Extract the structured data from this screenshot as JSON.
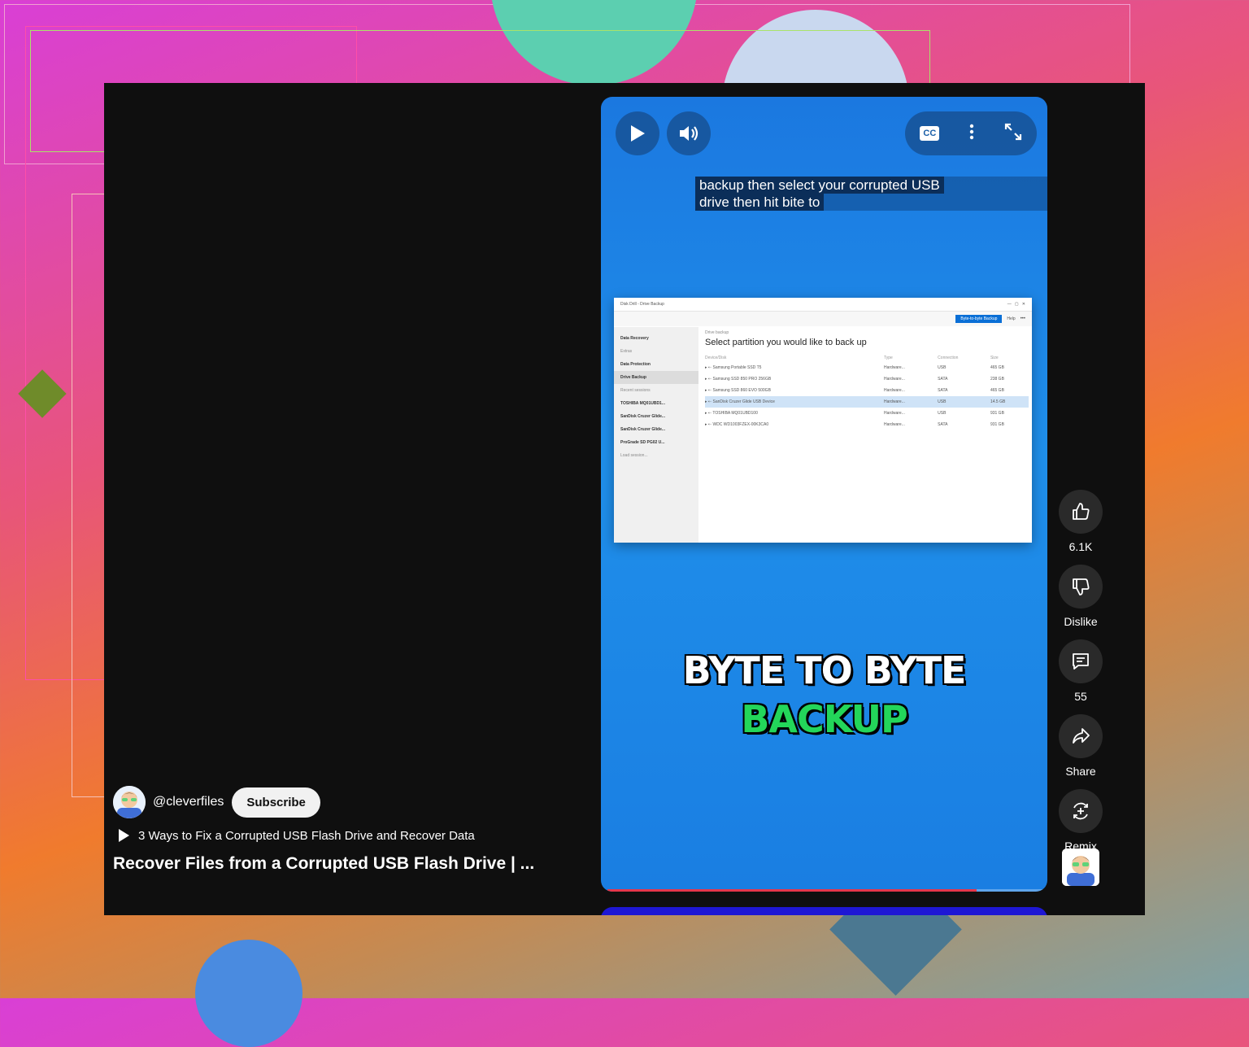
{
  "video": {
    "caption_line1": "backup then select your corrupted USB",
    "caption_line2": "drive then hit bite to",
    "overlay_line1": "BYTE TO BYTE",
    "overlay_line2": "BACKUP",
    "progress": 0.84,
    "controls": {
      "play_icon": "play-icon",
      "volume_icon": "volume-icon",
      "cc_label": "CC"
    }
  },
  "embedded_window": {
    "title": "Disk Drill - Drive Backup",
    "primary_button": "Byte-to-byte Backup",
    "help_label": "Help",
    "crumb": "Drive backup",
    "heading": "Select partition you would like to back up",
    "sidebar": [
      {
        "label": "Data Recovery",
        "style": "bold"
      },
      {
        "label": "Extras",
        "style": "muted"
      },
      {
        "label": "Data Protection",
        "style": "bold"
      },
      {
        "label": "Drive Backup",
        "style": "sel"
      },
      {
        "label": "Recent sessions",
        "style": "muted"
      },
      {
        "label": "TOSHIBA MQ01UBD1...",
        "style": "bold"
      },
      {
        "label": "SanDisk Cruzer Glide...",
        "style": "bold"
      },
      {
        "label": "SanDisk Cruzer Glide...",
        "style": "bold"
      },
      {
        "label": "ProGrade SD PG02 U...",
        "style": "bold"
      },
      {
        "label": "Load session...",
        "style": "muted"
      }
    ],
    "columns": [
      "Device/Disk",
      "Type",
      "Connection",
      "Size"
    ],
    "rows": [
      {
        "name": "Samsung Portable SSD T5",
        "type": "Hardware...",
        "conn": "USB",
        "size": "465 GB",
        "selected": false
      },
      {
        "name": "Samsung SSD 850 PRO 256GB",
        "type": "Hardware...",
        "conn": "SATA",
        "size": "238 GB",
        "selected": false
      },
      {
        "name": "Samsung SSD 860 EVO 500GB",
        "type": "Hardware...",
        "conn": "SATA",
        "size": "465 GB",
        "selected": false
      },
      {
        "name": "SanDisk Cruzer Glide USB Device",
        "type": "Hardware...",
        "conn": "USB",
        "size": "14.5 GB",
        "selected": true
      },
      {
        "name": "TOSHIBA MQ01UBD100",
        "type": "Hardware...",
        "conn": "USB",
        "size": "931 GB",
        "selected": false
      },
      {
        "name": "WDC WD1003FZEX-00K3CA0",
        "type": "Hardware...",
        "conn": "SATA",
        "size": "931 GB",
        "selected": false
      }
    ]
  },
  "actions": {
    "like_count": "6.1K",
    "dislike_label": "Dislike",
    "comment_count": "55",
    "share_label": "Share",
    "remix_label": "Remix"
  },
  "channel": {
    "handle": "@cleverfiles",
    "subscribe_label": "Subscribe"
  },
  "related_video": "3 Ways to Fix a Corrupted USB Flash Drive and Recover Data",
  "short_title": "Recover Files from a Corrupted USB Flash Drive | ...",
  "colors": {
    "accent_red": "#e5374b",
    "overlay_green": "#23d65a",
    "panel_bg": "#0f0f0f"
  }
}
